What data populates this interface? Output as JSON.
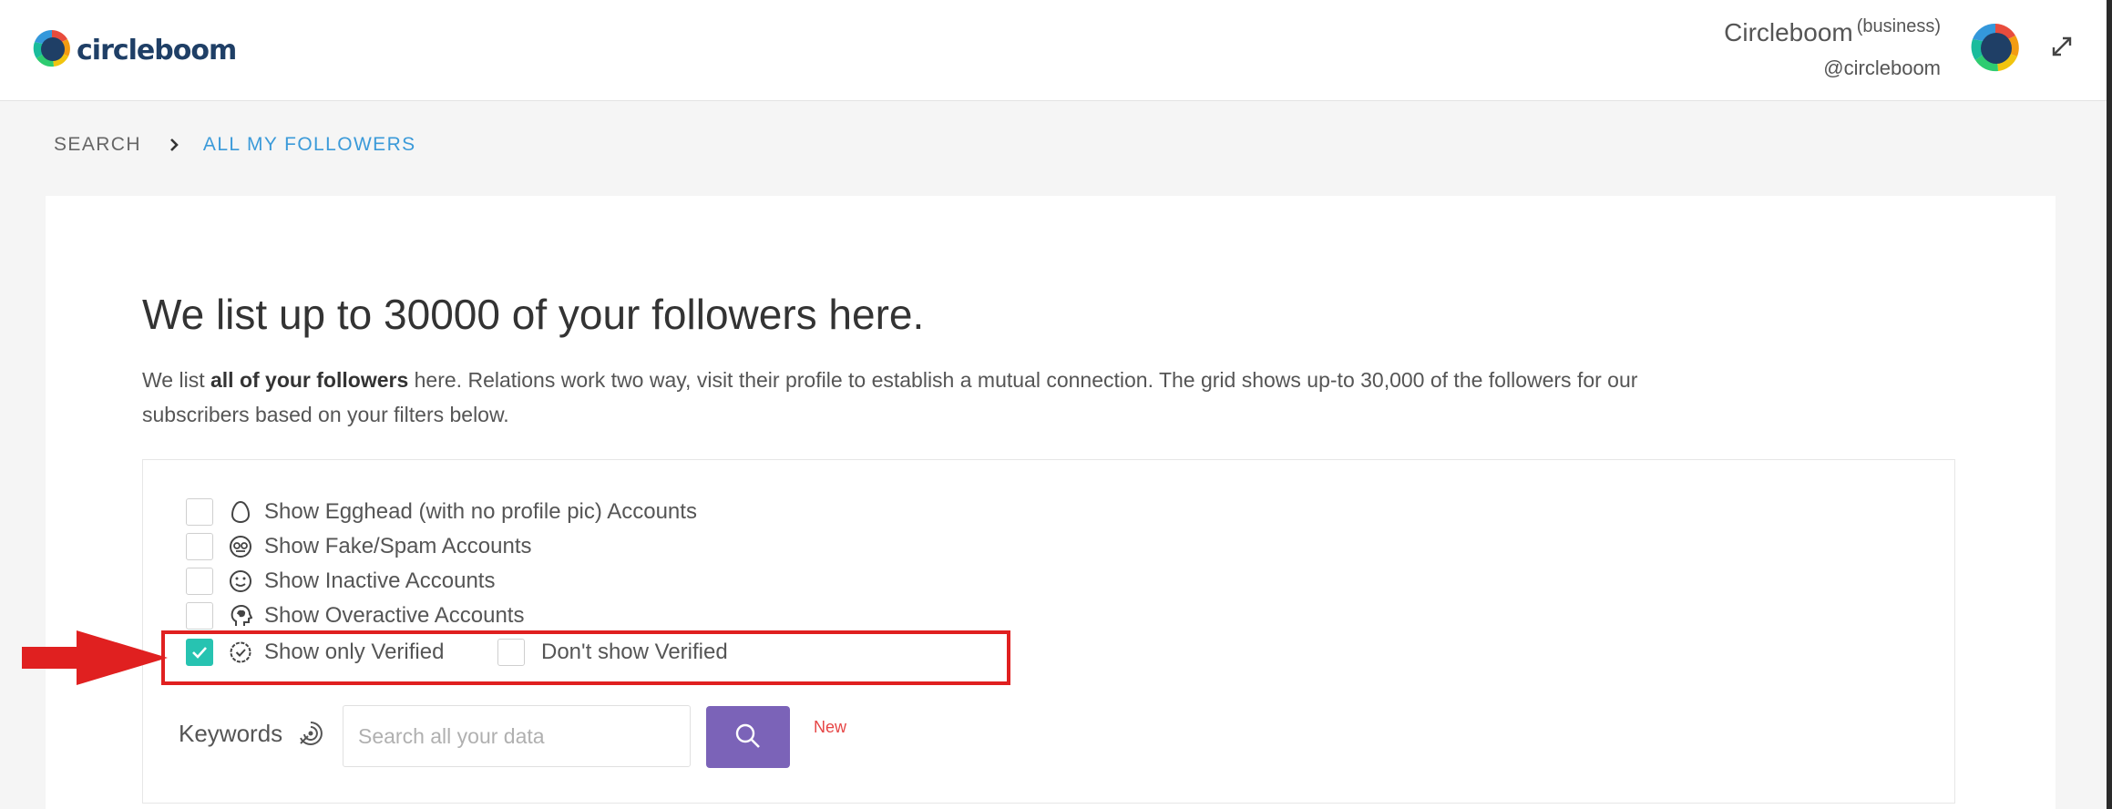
{
  "header": {
    "logo_text": "circleboom",
    "user_name": "Circleboom",
    "account_type": "(business)",
    "user_handle": "@circleboom",
    "icons": {
      "logo": "circleboom-logo-icon",
      "avatar": "circleboom-avatar",
      "expand": "expand-icon"
    }
  },
  "breadcrumb": {
    "items": [
      "SEARCH",
      "ALL MY FOLLOWERS"
    ]
  },
  "main": {
    "title": "We list up to 30000 of your followers here.",
    "intro_prefix": "We list ",
    "intro_bold": "all of your followers",
    "intro_suffix": " here. Relations work two way, visit their profile to establish a mutual connection. The grid shows up-to 30,000 of the followers for our subscribers based on your filters below."
  },
  "filters": {
    "items": [
      {
        "label": "Show Egghead (with no profile pic) Accounts",
        "icon": "egg-icon",
        "checked": false
      },
      {
        "label": "Show Fake/Spam Accounts",
        "icon": "spam-mask-icon",
        "checked": false
      },
      {
        "label": "Show Inactive Accounts",
        "icon": "smiley-icon",
        "checked": false
      },
      {
        "label": "Show Overactive Accounts",
        "icon": "brain-head-icon",
        "checked": false
      },
      {
        "label": "Show only Verified",
        "icon": "verified-badge-icon",
        "checked": true
      }
    ],
    "dont_show_verified": {
      "label": "Don't show Verified",
      "checked": false
    }
  },
  "keywords": {
    "label": "Keywords",
    "icon": "keywords-target-icon",
    "placeholder": "Search all your data",
    "value": "",
    "search_icon": "search-icon",
    "new_badge": "New"
  },
  "colors": {
    "brand_navy": "#1f3f66",
    "breadcrumb_active": "#3b9ad9",
    "checkbox_checked": "#27c3b1",
    "search_button": "#7b63b8",
    "new_badge": "#e64545",
    "annotation_red": "#e02020"
  }
}
